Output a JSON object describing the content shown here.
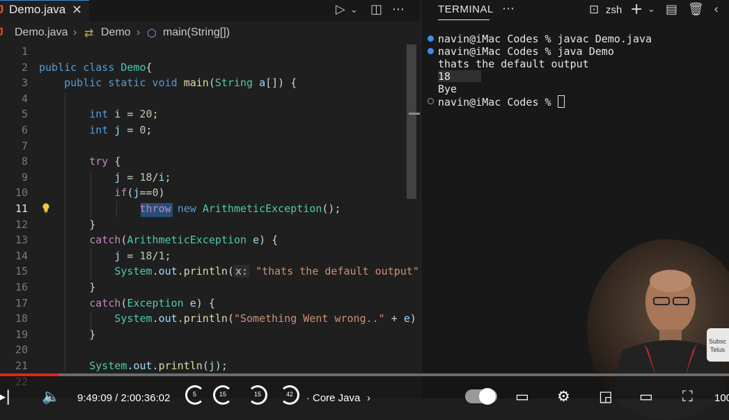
{
  "editor": {
    "tab": {
      "icon": "J",
      "name": "Demo.java"
    },
    "breadcrumb": [
      "Demo.java",
      "Demo",
      "main(String[])"
    ],
    "lines": [
      {
        "n": "1",
        "c": []
      },
      {
        "n": "2",
        "c": [
          [
            "kw",
            "public class "
          ],
          [
            "cls",
            "Demo"
          ],
          [
            "plain",
            "{"
          ]
        ]
      },
      {
        "n": "3",
        "c": [
          [
            "plain",
            "    "
          ],
          [
            "kw",
            "public static void "
          ],
          [
            "fn",
            "main"
          ],
          [
            "plain",
            "("
          ],
          [
            "cls",
            "String"
          ],
          [
            "plain",
            " "
          ],
          [
            "var",
            "a"
          ],
          [
            "plain",
            "[]) {"
          ]
        ]
      },
      {
        "n": "4",
        "c": []
      },
      {
        "n": "5",
        "c": [
          [
            "plain",
            "        "
          ],
          [
            "kw",
            "int "
          ],
          [
            "var",
            "i"
          ],
          [
            "plain",
            " = "
          ],
          [
            "num",
            "20"
          ],
          [
            "plain",
            ";"
          ]
        ]
      },
      {
        "n": "6",
        "c": [
          [
            "plain",
            "        "
          ],
          [
            "kw",
            "int "
          ],
          [
            "var",
            "j"
          ],
          [
            "plain",
            " = "
          ],
          [
            "num",
            "0"
          ],
          [
            "plain",
            ";"
          ]
        ]
      },
      {
        "n": "7",
        "c": []
      },
      {
        "n": "8",
        "c": [
          [
            "plain",
            "        "
          ],
          [
            "ctl",
            "try "
          ],
          [
            "plain",
            "{"
          ]
        ]
      },
      {
        "n": "9",
        "c": [
          [
            "plain",
            "            "
          ],
          [
            "var",
            "j"
          ],
          [
            "plain",
            " = "
          ],
          [
            "num",
            "18"
          ],
          [
            "plain",
            "/"
          ],
          [
            "var",
            "i"
          ],
          [
            "plain",
            ";"
          ]
        ]
      },
      {
        "n": "10",
        "c": [
          [
            "plain",
            "            "
          ],
          [
            "ctl",
            "if"
          ],
          [
            "plain",
            "("
          ],
          [
            "var",
            "j"
          ],
          [
            "plain",
            "=="
          ],
          [
            "num",
            "0"
          ],
          [
            "plain",
            ")"
          ]
        ]
      },
      {
        "n": "11",
        "c": [
          [
            "plain",
            "                "
          ],
          [
            "ctl",
            "throw "
          ],
          [
            "kw",
            "new "
          ],
          [
            "cls",
            "ArithmeticException"
          ],
          [
            "plain",
            "();"
          ]
        ]
      },
      {
        "n": "12",
        "c": [
          [
            "plain",
            "        }"
          ]
        ]
      },
      {
        "n": "13",
        "c": [
          [
            "plain",
            "        "
          ],
          [
            "ctl",
            "catch"
          ],
          [
            "plain",
            "("
          ],
          [
            "cls",
            "ArithmeticException"
          ],
          [
            "plain",
            " "
          ],
          [
            "var",
            "e"
          ],
          [
            "plain",
            ") {"
          ]
        ]
      },
      {
        "n": "14",
        "c": [
          [
            "plain",
            "            "
          ],
          [
            "var",
            "j"
          ],
          [
            "plain",
            " = "
          ],
          [
            "num",
            "18"
          ],
          [
            "plain",
            "/"
          ],
          [
            "num",
            "1"
          ],
          [
            "plain",
            ";"
          ]
        ]
      },
      {
        "n": "15",
        "c": [
          [
            "plain",
            "            "
          ],
          [
            "cls",
            "System"
          ],
          [
            "plain",
            "."
          ],
          [
            "var",
            "out"
          ],
          [
            "plain",
            "."
          ],
          [
            "fn",
            "println"
          ],
          [
            "plain",
            "("
          ],
          [
            "hint",
            "x:"
          ],
          [
            "plain",
            " "
          ],
          [
            "str",
            "\"thats the default output\""
          ]
        ]
      },
      {
        "n": "16",
        "c": [
          [
            "plain",
            "        }"
          ]
        ]
      },
      {
        "n": "17",
        "c": [
          [
            "plain",
            "        "
          ],
          [
            "ctl",
            "catch"
          ],
          [
            "plain",
            "("
          ],
          [
            "cls",
            "Exception"
          ],
          [
            "plain",
            " "
          ],
          [
            "var",
            "e"
          ],
          [
            "plain",
            ") {"
          ]
        ]
      },
      {
        "n": "18",
        "c": [
          [
            "plain",
            "            "
          ],
          [
            "cls",
            "System"
          ],
          [
            "plain",
            "."
          ],
          [
            "var",
            "out"
          ],
          [
            "plain",
            "."
          ],
          [
            "fn",
            "println"
          ],
          [
            "plain",
            "("
          ],
          [
            "str",
            "\"Something Went wrong..\""
          ],
          [
            "plain",
            " + "
          ],
          [
            "var",
            "e"
          ],
          [
            "plain",
            ")"
          ]
        ]
      },
      {
        "n": "19",
        "c": [
          [
            "plain",
            "        }"
          ]
        ]
      },
      {
        "n": "20",
        "c": []
      },
      {
        "n": "21",
        "c": [
          [
            "plain",
            "        "
          ],
          [
            "cls",
            "System"
          ],
          [
            "plain",
            "."
          ],
          [
            "var",
            "out"
          ],
          [
            "plain",
            "."
          ],
          [
            "fn",
            "println"
          ],
          [
            "plain",
            "("
          ],
          [
            "var",
            "j"
          ],
          [
            "plain",
            ");"
          ]
        ]
      },
      {
        "n": "22",
        "c": []
      }
    ],
    "active_line": "11"
  },
  "terminal": {
    "title": "TERMINAL",
    "shell": "zsh",
    "lines": [
      {
        "dot": "#3b8eea",
        "text": "navin@iMac Codes % javac Demo.java"
      },
      {
        "dot": "#3b8eea",
        "text": "navin@iMac Codes % java Demo"
      },
      {
        "dot": null,
        "text": "thats the default output"
      },
      {
        "dot": null,
        "text": "18"
      },
      {
        "dot": null,
        "text": "Bye"
      },
      {
        "dot": "hollow",
        "text": "navin@iMac Codes % "
      }
    ]
  },
  "player": {
    "time": "9:49:09 / 2:00:36:02",
    "chapter": "Core Java",
    "skips": [
      "5",
      "15",
      "15",
      "42"
    ],
    "volume": "100",
    "subscribe": [
      "Subsc",
      "Telus"
    ],
    "progress_fraction": 0.081
  }
}
